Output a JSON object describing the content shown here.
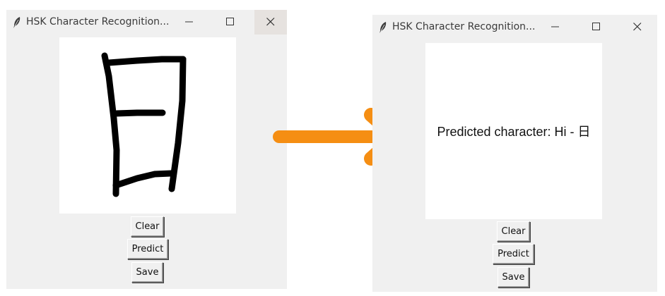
{
  "windows": [
    {
      "title": "HSK Character Recognition...",
      "buttons": {
        "clear": "Clear",
        "predict": "Predict",
        "save": "Save"
      }
    },
    {
      "title": "HSK Character Recognition...",
      "prediction_text": "Predicted character: Hi - 日",
      "buttons": {
        "clear": "Clear",
        "predict": "Predict",
        "save": "Save"
      }
    }
  ],
  "icons": [
    "tk-feather-icon",
    "minimize-icon",
    "maximize-icon",
    "close-icon",
    "right-arrow-icon"
  ],
  "colors": {
    "arrow": "#f58e13",
    "window_bg": "#f0f0f0",
    "canvas_bg": "#ffffff",
    "stroke": "#000000"
  }
}
